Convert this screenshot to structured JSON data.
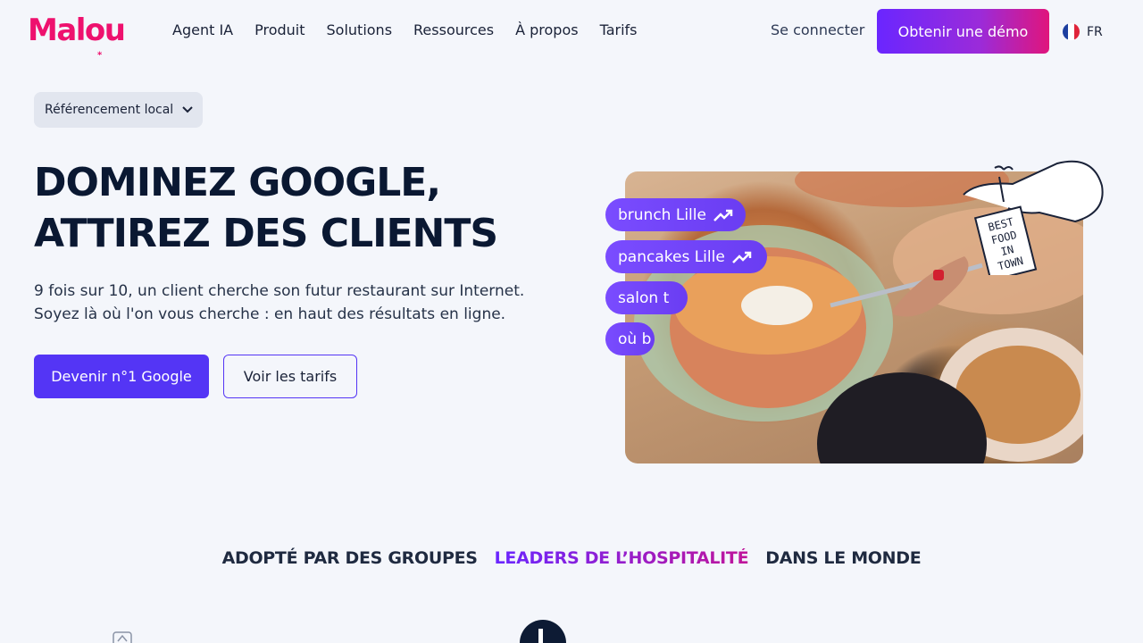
{
  "header": {
    "logo": "Malou",
    "nav": [
      "Agent IA",
      "Produit",
      "Solutions",
      "Ressources",
      "À propos",
      "Tarifs"
    ],
    "signin_label": "Se connecter",
    "demo_label": "Obtenir une démo",
    "lang_label": "FR"
  },
  "hero": {
    "pill_label": "Référencement local",
    "title_line1": "DOMINEZ GOOGLE,",
    "title_line2": "ATTIREZ DES CLIENTS",
    "subtitle_line1": "9 fois sur 10, un client cherche son futur restaurant sur Internet.",
    "subtitle_line2": "Soyez là où l'on vous cherche : en haut des résultats en ligne.",
    "primary_cta": "Devenir n°1 Google",
    "secondary_cta": "Voir les tarifs",
    "chips": [
      "brunch Lille",
      "pancakes Lille",
      "salon t",
      "où b"
    ],
    "sticker_text": [
      "BEST",
      "FOOD",
      "IN",
      "TOWN"
    ]
  },
  "band": {
    "part1": "ADOPTÉ PAR DES GROUPES",
    "part2": "LEADERS DE L’HOSPITALITÉ",
    "part3": "DANS LE MONDE"
  },
  "colors": {
    "brand_pink": "#ee116e",
    "primary_purple": "#5435f5",
    "background": "#f4f6fb"
  }
}
